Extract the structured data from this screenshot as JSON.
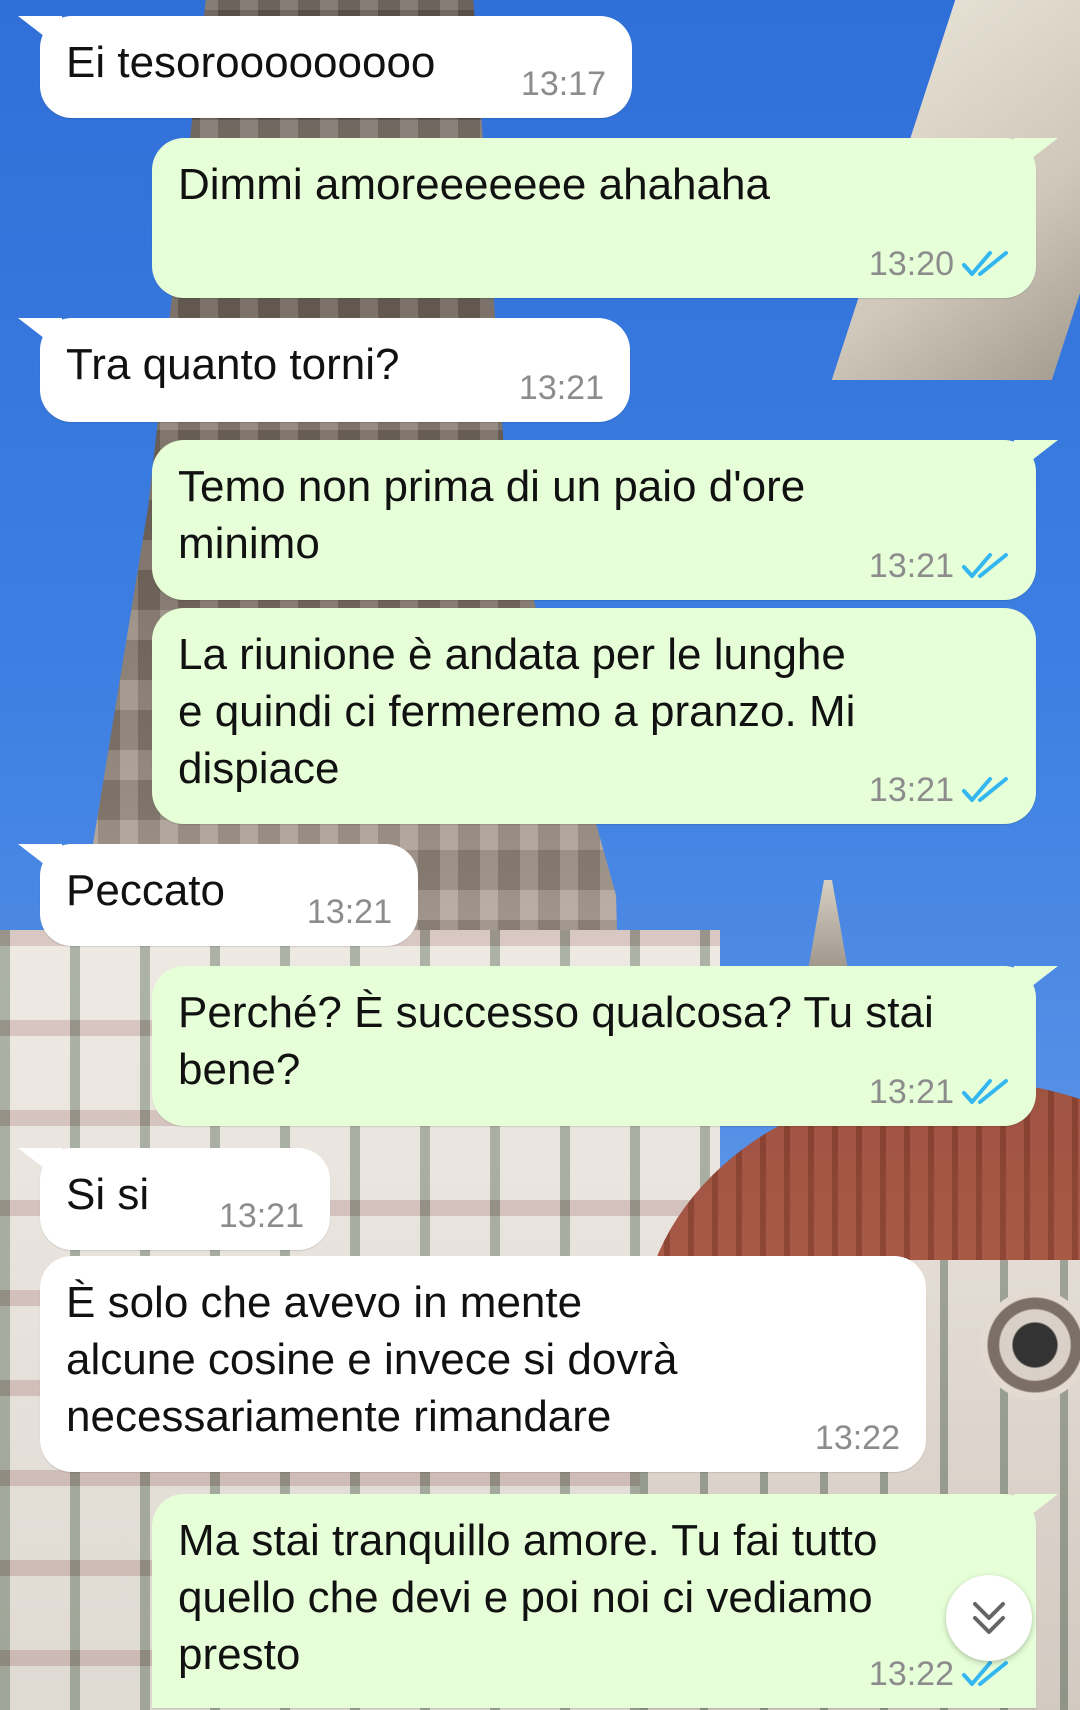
{
  "colors": {
    "incoming_bubble": "#ffffff",
    "outgoing_bubble": "#e6ffd8",
    "timestamp": "#8c8c8c",
    "read_ticks": "#34b7f1"
  },
  "messages": [
    {
      "direction": "incoming",
      "text": "Ei tesorooooooooo",
      "time": "13:17"
    },
    {
      "direction": "outgoing",
      "text": "Dimmi amoreeeeeee ahahaha",
      "time": "13:20",
      "status_icon": "double-check-read-icon"
    },
    {
      "direction": "incoming",
      "text": "Tra quanto torni?",
      "time": "13:21"
    },
    {
      "direction": "outgoing",
      "text": "Temo non prima di un paio d'ore\nminimo",
      "time": "13:21",
      "status_icon": "double-check-read-icon"
    },
    {
      "direction": "outgoing",
      "text": "La riunione è andata per le lunghe\ne quindi ci fermeremo a pranzo. Mi\ndispiace",
      "time": "13:21",
      "status_icon": "double-check-read-icon"
    },
    {
      "direction": "incoming",
      "text": "Peccato",
      "time": "13:21"
    },
    {
      "direction": "outgoing",
      "text": "Perché? È successo qualcosa? Tu stai\nbene?",
      "time": "13:21",
      "status_icon": "double-check-read-icon"
    },
    {
      "direction": "incoming",
      "text": "Si si",
      "time": "13:21"
    },
    {
      "direction": "incoming",
      "text": "È solo che avevo in mente\nalcune cosine e invece si dovrà\nnecessariamente rimandare",
      "time": "13:22"
    },
    {
      "direction": "outgoing",
      "text": "Ma stai tranquillo amore. Tu fai tutto\nquello che devi e poi noi ci vediamo\npresto",
      "time": "13:22",
      "status_icon": "double-check-read-icon"
    }
  ],
  "scroll_button_icon": "double-chevron-down-icon"
}
